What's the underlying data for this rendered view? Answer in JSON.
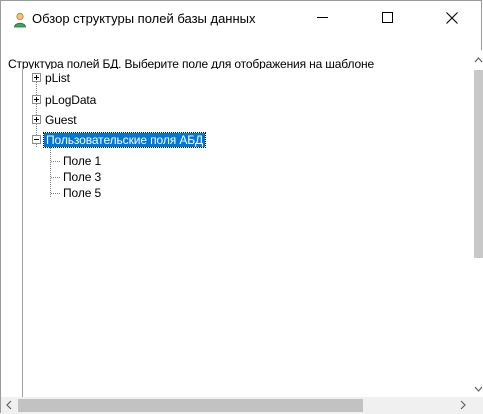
{
  "window": {
    "title": "Обзор структуры полей базы данных",
    "icon": "user-icon"
  },
  "instruction": "Структура полей БД. Выберите поле для отображения на шаблоне",
  "tree": {
    "nodes": [
      {
        "label": "pList",
        "state": "collapsed"
      },
      {
        "label": "pLogData",
        "state": "collapsed"
      },
      {
        "label": "Guest",
        "state": "collapsed"
      },
      {
        "label": "Пользовательские поля АБД",
        "state": "expanded",
        "selected": true,
        "children": [
          {
            "label": "Поле 1"
          },
          {
            "label": "Поле 3"
          },
          {
            "label": "Поле 5"
          }
        ]
      }
    ]
  },
  "colors": {
    "selection": "#0078d7",
    "selection_text": "#ffffff",
    "scroll_thumb": "#c8c8c8"
  },
  "icons": {
    "minimize": "minimize-icon",
    "maximize": "maximize-icon",
    "close": "close-icon",
    "scroll_up": "chevron-up-icon",
    "scroll_down": "chevron-down-icon",
    "scroll_left": "chevron-left-icon",
    "scroll_right": "chevron-right-icon"
  }
}
